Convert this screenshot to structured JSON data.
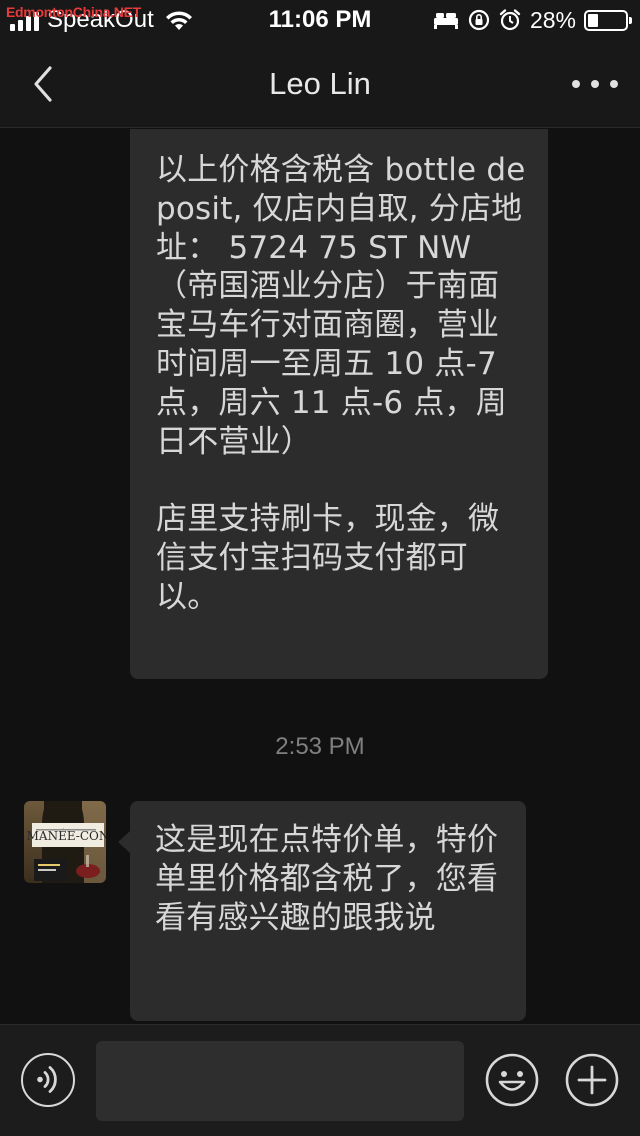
{
  "status_bar": {
    "watermark": "EdmontonChina.NET",
    "carrier": "SpeakOut",
    "time": "11:06 PM",
    "battery_percent": "28%",
    "battery_level": 0.28
  },
  "nav": {
    "title": "Leo Lin"
  },
  "messages": [
    {
      "sender": "contact",
      "paragraphs": [
        "以上价格含税含 bottle deposit, 仅店内自取, 分店地址： 5724 75 ST NW （帝国酒业分店）于南面宝马车行对面商圈，营业时间周一至周五 10 点-7 点，周六 11 点-6 点，周日不营业）",
        "店里支持刷卡，现金，微信支付宝扫码支付都可以。"
      ]
    },
    {
      "type": "timestamp",
      "text": "2:53 PM"
    },
    {
      "sender": "contact",
      "paragraphs": [
        "这是现在点特价单，特价单里价格都含税了，您看看有感兴趣的跟我说"
      ]
    }
  ],
  "colors": {
    "background": "#111111",
    "bubble": "#2c2c2c",
    "bar": "#181818",
    "text": "#d7d7d7",
    "watermark": "#e83a3a"
  },
  "icons": [
    "back-arrow-icon",
    "more-dots-icon",
    "voice-icon",
    "emoji-icon",
    "plus-icon",
    "wifi-icon",
    "signal-icon",
    "alarm-icon",
    "rotation-lock-icon",
    "bed-icon",
    "battery-icon"
  ]
}
